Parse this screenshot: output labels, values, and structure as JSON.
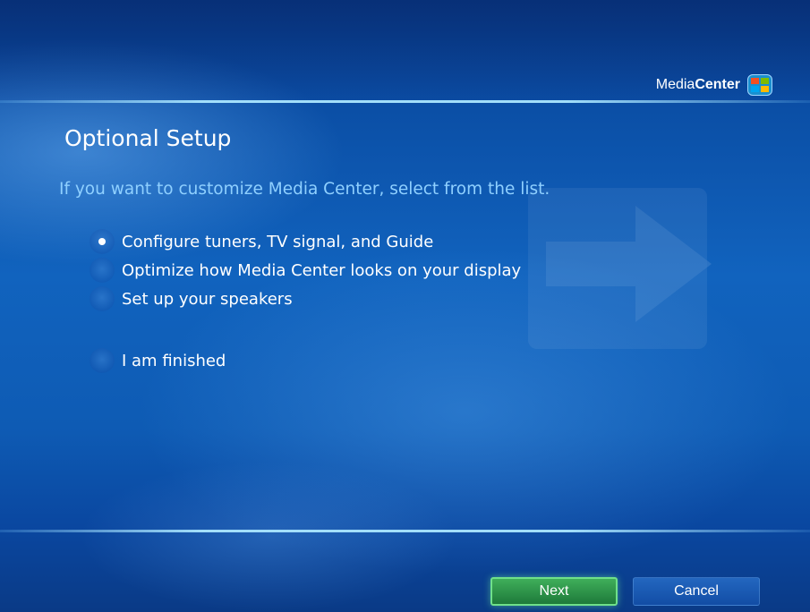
{
  "app": {
    "logo_prefix": "Media",
    "logo_bold": "Center"
  },
  "page": {
    "title": "Optional Setup",
    "subtitle": "If you want to customize Media Center, select from the list."
  },
  "options": [
    {
      "label": "Configure tuners, TV signal, and Guide",
      "selected": true
    },
    {
      "label": "Optimize how Media Center looks on your display",
      "selected": false
    },
    {
      "label": "Set up your speakers",
      "selected": false
    },
    {
      "label": "I am finished",
      "selected": false
    }
  ],
  "buttons": {
    "next_label": "Next",
    "cancel_label": "Cancel"
  },
  "colors": {
    "background": "#0b4fa6",
    "subtitle": "#8fd0ff",
    "next_button": "#2f9a4c"
  },
  "icons": {
    "logo": "windows-flag-icon",
    "radio": "radio-icon",
    "watermark": "arrow-icon"
  }
}
